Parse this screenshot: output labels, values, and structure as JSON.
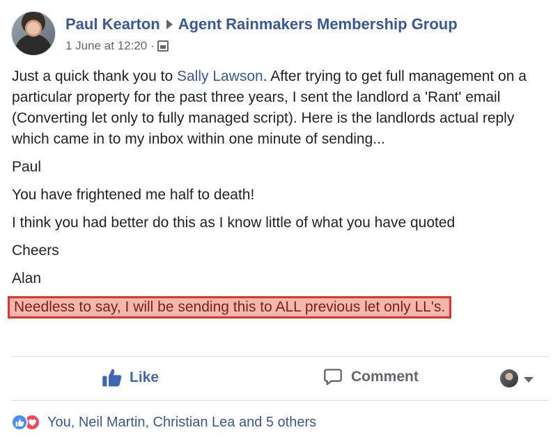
{
  "post": {
    "author": "Paul Kearton",
    "group": "Agent Rainmakers Membership Group",
    "timestamp": "1 June at 12:20",
    "meta_separator": "·",
    "privacy_icon": "group-icon",
    "body": {
      "p1_before": "Just a quick thank you to ",
      "mention": "Sally Lawson",
      "p1_after": ". After trying to get full management on a particular property for the past three years, I sent the landlord a 'Rant' email (Converting let only to fully managed script). Here is the landlords actual reply which came in to my inbox within one minute of sending...",
      "p2": "Paul",
      "p3": "You have frightened me half to death!",
      "p4": "I think you had better do this as I know little of what you have quoted",
      "p5": "Cheers",
      "p6": "Alan",
      "highlighted": "Needless to say, I will be sending this to ALL previous let only LL's."
    }
  },
  "actions": {
    "like_label": "Like",
    "comment_label": "Comment",
    "like_icon": "thumbs-up-icon",
    "comment_icon": "speech-bubble-icon"
  },
  "reactions": {
    "text": "You, Neil Martin, Christian Lea and 5 others",
    "icons": [
      "like-reaction-icon",
      "love-reaction-icon"
    ]
  },
  "colors": {
    "link": "#385898",
    "like_blue": "#4267b2",
    "highlight_fill": "#f4b6ad",
    "highlight_border": "#e0332a"
  }
}
